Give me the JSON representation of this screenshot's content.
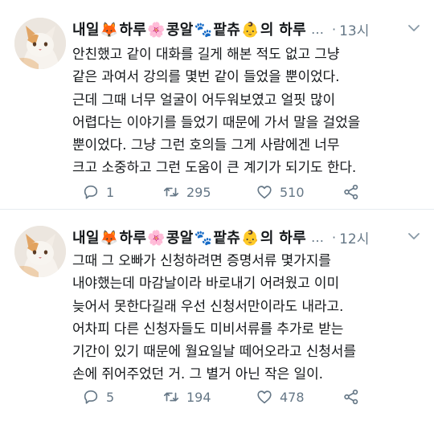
{
  "tweets": [
    {
      "author": {
        "name_parts": [
          "내일",
          "🦊",
          "하루",
          "🌸",
          "콩알",
          "🐾",
          "팥츄",
          "👶",
          "의 하루"
        ],
        "truncation": "…"
      },
      "separator": "·",
      "time": "13시",
      "lines": [
        "안친했고 같이 대화를 길게 해본 적도 없고 그냥",
        "같은 과여서 강의를 몇번 같이 들었을 뿐이었다.",
        "근데 그때 너무 얼굴이 어두워보였고 얼핏 많이",
        "어렵다는 이야기를 들었기 때문에 가서 말을 걸었을",
        "뿐이었다. 그냥 그런 호의들 그게 사람에겐 너무",
        "크고 소중하고 그런 도움이 큰 계기가 되기도 한다."
      ],
      "stats": {
        "replies": "1",
        "retweets": "295",
        "likes": "510"
      }
    },
    {
      "author": {
        "name_parts": [
          "내일",
          "🦊",
          "하루",
          "🌸",
          "콩알",
          "🐾",
          "팥츄",
          "👶",
          "의 하루"
        ],
        "truncation": "…"
      },
      "separator": "·",
      "time": "12시",
      "lines": [
        "그때 그 오빠가 신청하려면 증명서류 몇가지를",
        "내야했는데 마감날이라 바로내기 어려웠고 이미",
        "늦어서 못한다길래 우선 신청서만이라도 내라고.",
        "어차피 다른 신청자들도 미비서류를 추가로 받는",
        "기간이 있기 때문에 월요일날 떼어오라고 신청서를",
        "손에 쥐어주었던 거. 그 별거 아닌 작은 일이."
      ],
      "stats": {
        "replies": "5",
        "retweets": "194",
        "likes": "478"
      }
    }
  ],
  "icons": {
    "reply": "reply-icon",
    "retweet": "retweet-icon",
    "like": "heart-icon",
    "share": "share-icon",
    "menu": "chevron-down-icon",
    "avatar": "cat-avatar"
  },
  "colors": {
    "text": "#14171a",
    "secondary": "#657786",
    "divider": "#e6ecf0"
  }
}
